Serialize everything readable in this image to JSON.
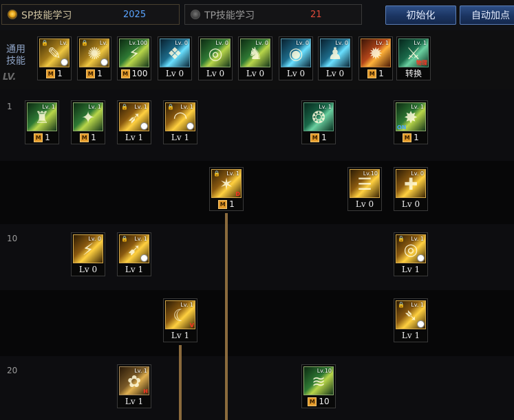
{
  "sp_tab": {
    "label": "SP技能学习",
    "value": "2025"
  },
  "tp_tab": {
    "label": "TP技能学习",
    "value": "21"
  },
  "buttons": {
    "reset": "初始化",
    "auto": "自动加点"
  },
  "common": {
    "label_line1": "通用",
    "label_line2": "技能",
    "lv_label": "LV."
  },
  "levels": {
    "l1": "1",
    "l10": "10",
    "l20": "20"
  },
  "common_skills": [
    {
      "icon": "scroll-clock-skill-icon",
      "tag": "Lv.",
      "badge": "1",
      "marker": "M"
    },
    {
      "icon": "clock-swirl-skill-icon",
      "tag": "Lv.",
      "badge": "1",
      "marker": "M"
    },
    {
      "icon": "running-figure-skill-icon",
      "tag": "Lv.100",
      "badge": "100",
      "marker": "M"
    },
    {
      "icon": "wings-skill-icon",
      "tag": "Lv. 0",
      "badge": "Lv 0"
    },
    {
      "icon": "target-skill-icon",
      "tag": "Lv. 0",
      "badge": "Lv 0"
    },
    {
      "icon": "kneeling-figure-skill-icon",
      "tag": "Lv. 0",
      "badge": "Lv 0"
    },
    {
      "icon": "eye-skill-icon",
      "tag": "Lv. 0",
      "badge": "Lv 0"
    },
    {
      "icon": "body-skill-icon",
      "tag": "Lv. 0",
      "badge": "Lv 0"
    },
    {
      "icon": "flame-skill-icon",
      "tag": "Lv. 1",
      "badge": "1",
      "marker": "M"
    },
    {
      "icon": "physical-switch-skill-icon",
      "tag": "Lv. 1",
      "badge": "转换",
      "corner": "物理"
    }
  ],
  "tree_skills": [
    {
      "icon": "green-figure-skill-icon",
      "tag": "Lv. 1",
      "badge": "1",
      "marker": "M"
    },
    {
      "icon": "green-strike-skill-icon",
      "tag": "Lv. 1",
      "badge": "1",
      "marker": "M"
    },
    {
      "icon": "gold-slash-clock-skill-icon",
      "tag": "Lv. 1",
      "badge": "Lv 1"
    },
    {
      "icon": "gold-arc-clock-skill-icon",
      "tag": "Lv. 1",
      "badge": "Lv 1"
    },
    {
      "icon": "green-dragon-skill-icon",
      "tag": "Lv. 1",
      "badge": "1",
      "marker": "M"
    },
    {
      "icon": "green-burst-skill-icon",
      "tag": "Lv. 1",
      "badge": "1",
      "marker": "M",
      "corner": "ON"
    },
    {
      "icon": "gold-burst-lock-skill-icon",
      "tag": "Lv. 1",
      "badge": "1",
      "marker": "M",
      "corner": "D"
    },
    {
      "icon": "gold-fan-skill-icon",
      "tag": "Lv.10",
      "badge": "Lv 0"
    },
    {
      "icon": "cross-shield-skill-icon",
      "tag": "Lv. 0",
      "badge": "Lv 0"
    },
    {
      "icon": "gold-dash-skill-icon",
      "tag": "Lv. 0",
      "badge": "Lv 0"
    },
    {
      "icon": "gold-wave-clock-skill-icon",
      "tag": "Lv. 1",
      "badge": "Lv 1"
    },
    {
      "icon": "gold-ring-clock-skill-icon",
      "tag": "Lv. 1",
      "badge": "Lv 1"
    },
    {
      "icon": "gold-crescent-skill-icon",
      "tag": "Lv. 1",
      "badge": "Lv 1",
      "corner": "V"
    },
    {
      "icon": "gold-spin-clock-skill-icon",
      "tag": "Lv. 1",
      "badge": "Lv 1"
    },
    {
      "icon": "gold-figure-skill-icon",
      "tag": "Lv. 1",
      "badge": "Lv 1",
      "corner": "H"
    },
    {
      "icon": "green-wave-skill-icon",
      "tag": "Lv.10",
      "badge": "10",
      "marker": "M"
    }
  ]
}
